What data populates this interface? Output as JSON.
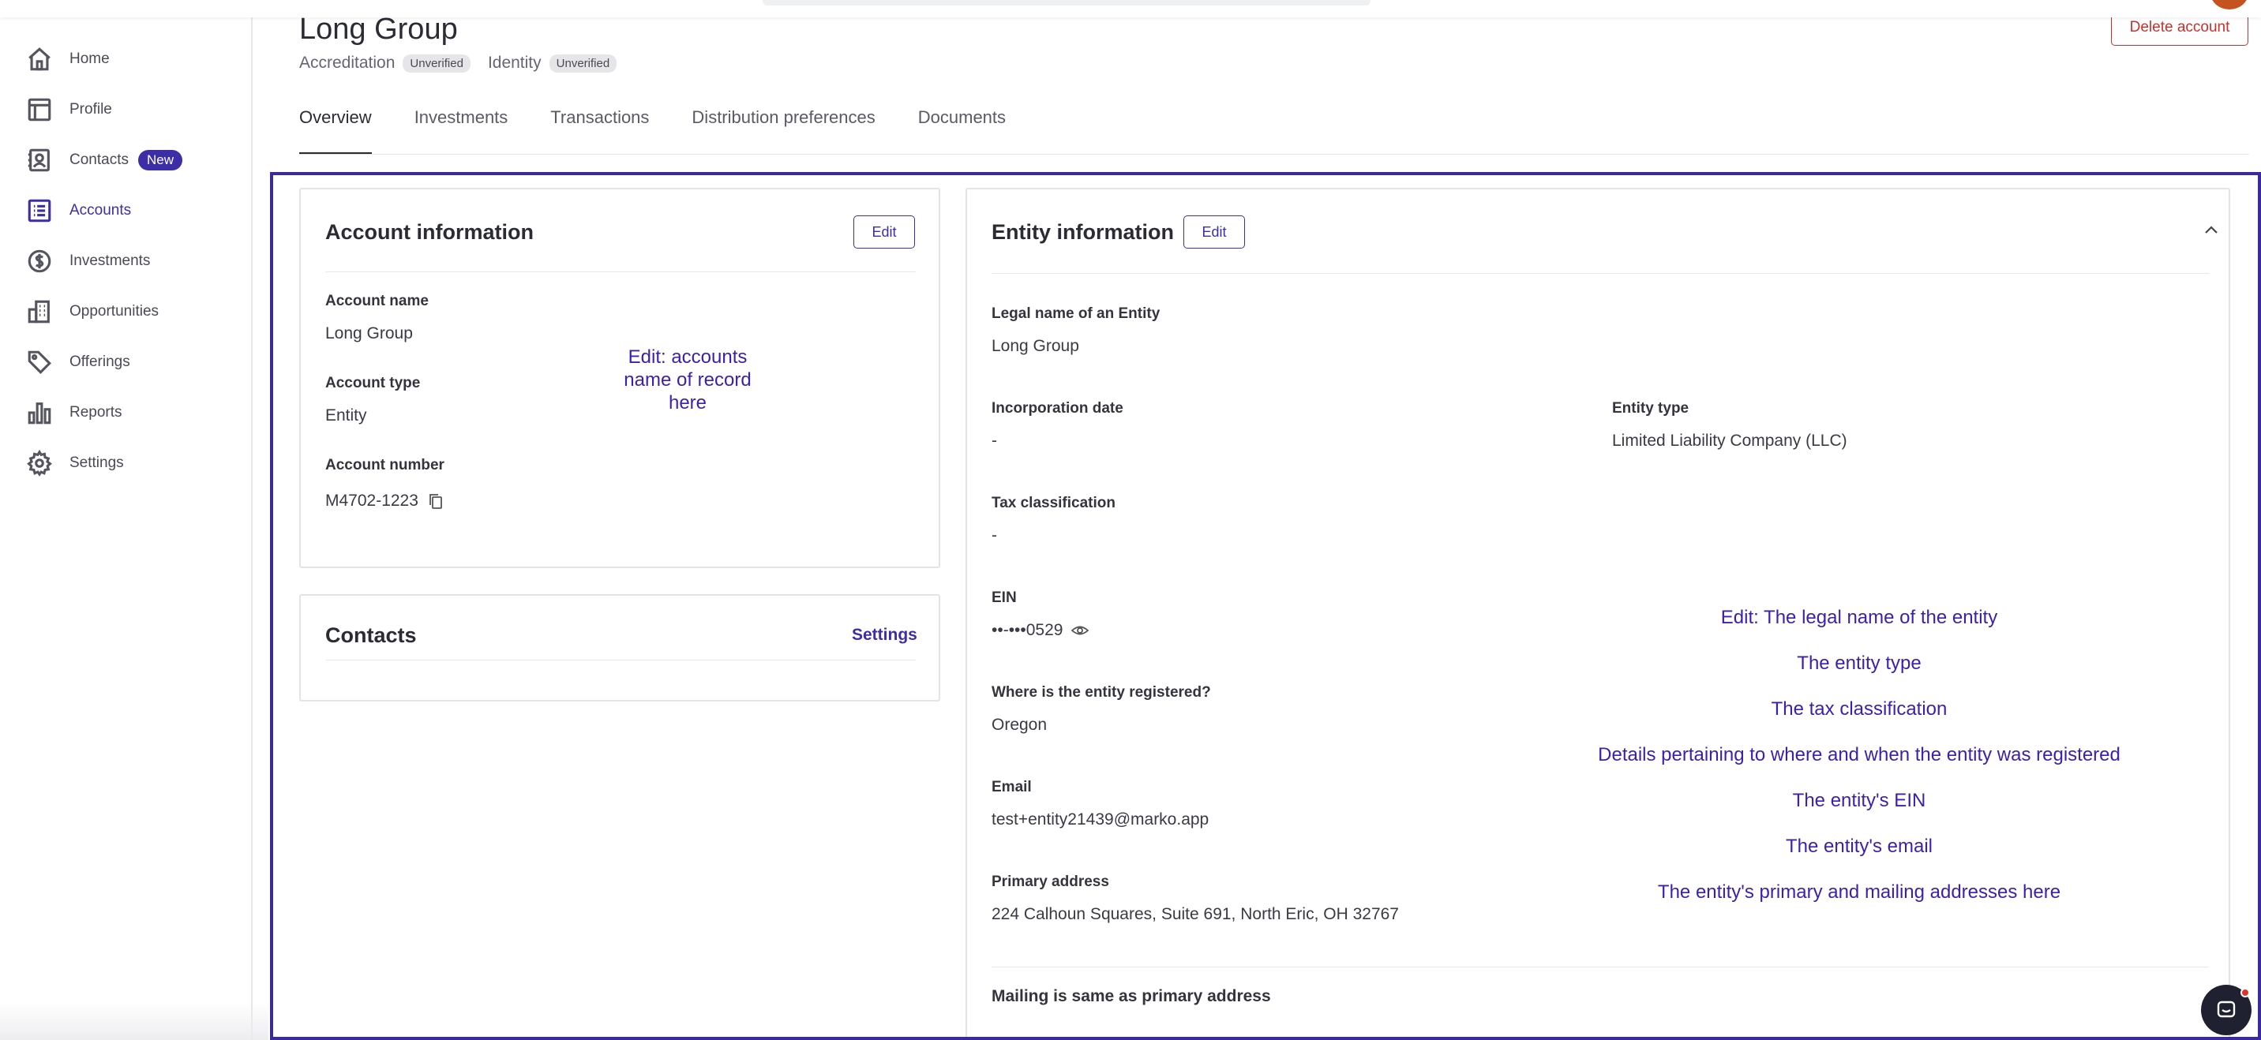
{
  "header": {
    "title": "Long Group",
    "accreditation_label": "Accreditation",
    "accreditation_status": "Unverified",
    "identity_label": "Identity",
    "identity_status": "Unverified",
    "delete_label": "Delete account"
  },
  "sidebar": {
    "items": [
      {
        "label": "Home",
        "icon": "home-icon"
      },
      {
        "label": "Profile",
        "icon": "profile-icon"
      },
      {
        "label": "Contacts",
        "icon": "contacts-icon",
        "badge": "New"
      },
      {
        "label": "Accounts",
        "icon": "accounts-icon",
        "active": true
      },
      {
        "label": "Investments",
        "icon": "dollar-icon"
      },
      {
        "label": "Opportunities",
        "icon": "building-icon"
      },
      {
        "label": "Offerings",
        "icon": "tag-icon"
      },
      {
        "label": "Reports",
        "icon": "bar-chart-icon"
      },
      {
        "label": "Settings",
        "icon": "gear-icon"
      }
    ]
  },
  "tabs": [
    "Overview",
    "Investments",
    "Transactions",
    "Distribution preferences",
    "Documents"
  ],
  "account_info": {
    "title": "Account information",
    "edit_label": "Edit",
    "name_label": "Account name",
    "name_value": "Long Group",
    "type_label": "Account type",
    "type_value": "Entity",
    "number_label": "Account number",
    "number_value": "M4702-1223",
    "annotation": "Edit: accounts name of record here"
  },
  "contacts_card": {
    "title": "Contacts",
    "settings_label": "Settings"
  },
  "entity_info": {
    "title": "Entity information",
    "edit_label": "Edit",
    "legal_name_label": "Legal name of an Entity",
    "legal_name_value": "Long Group",
    "incorporation_label": "Incorporation date",
    "incorporation_value": "-",
    "entity_type_label": "Entity type",
    "entity_type_value": "Limited Liability Company (LLC)",
    "tax_label": "Tax classification",
    "tax_value": "-",
    "ein_label": "EIN",
    "ein_value": "••-•••0529",
    "registered_label": "Where is the entity registered?",
    "registered_value": "Oregon",
    "email_label": "Email",
    "email_value": "test+entity21439@marko.app",
    "address_label": "Primary address",
    "address_value": "224 Calhoun Squares, Suite 691, North Eric, OH 32767",
    "mailing_label": "Mailing is same as primary address",
    "annotations": [
      "Edit: The legal name of the entity",
      "The entity type",
      "The tax classification",
      "Details pertaining to where and when the entity was registered",
      "The entity's EIN",
      "The entity's email",
      "The entity's primary and mailing addresses here"
    ]
  },
  "colors": {
    "accent": "#3b2ea6",
    "annotation": "#3b1fb0",
    "danger": "#c9302c",
    "frame": "#3b2a9e"
  }
}
